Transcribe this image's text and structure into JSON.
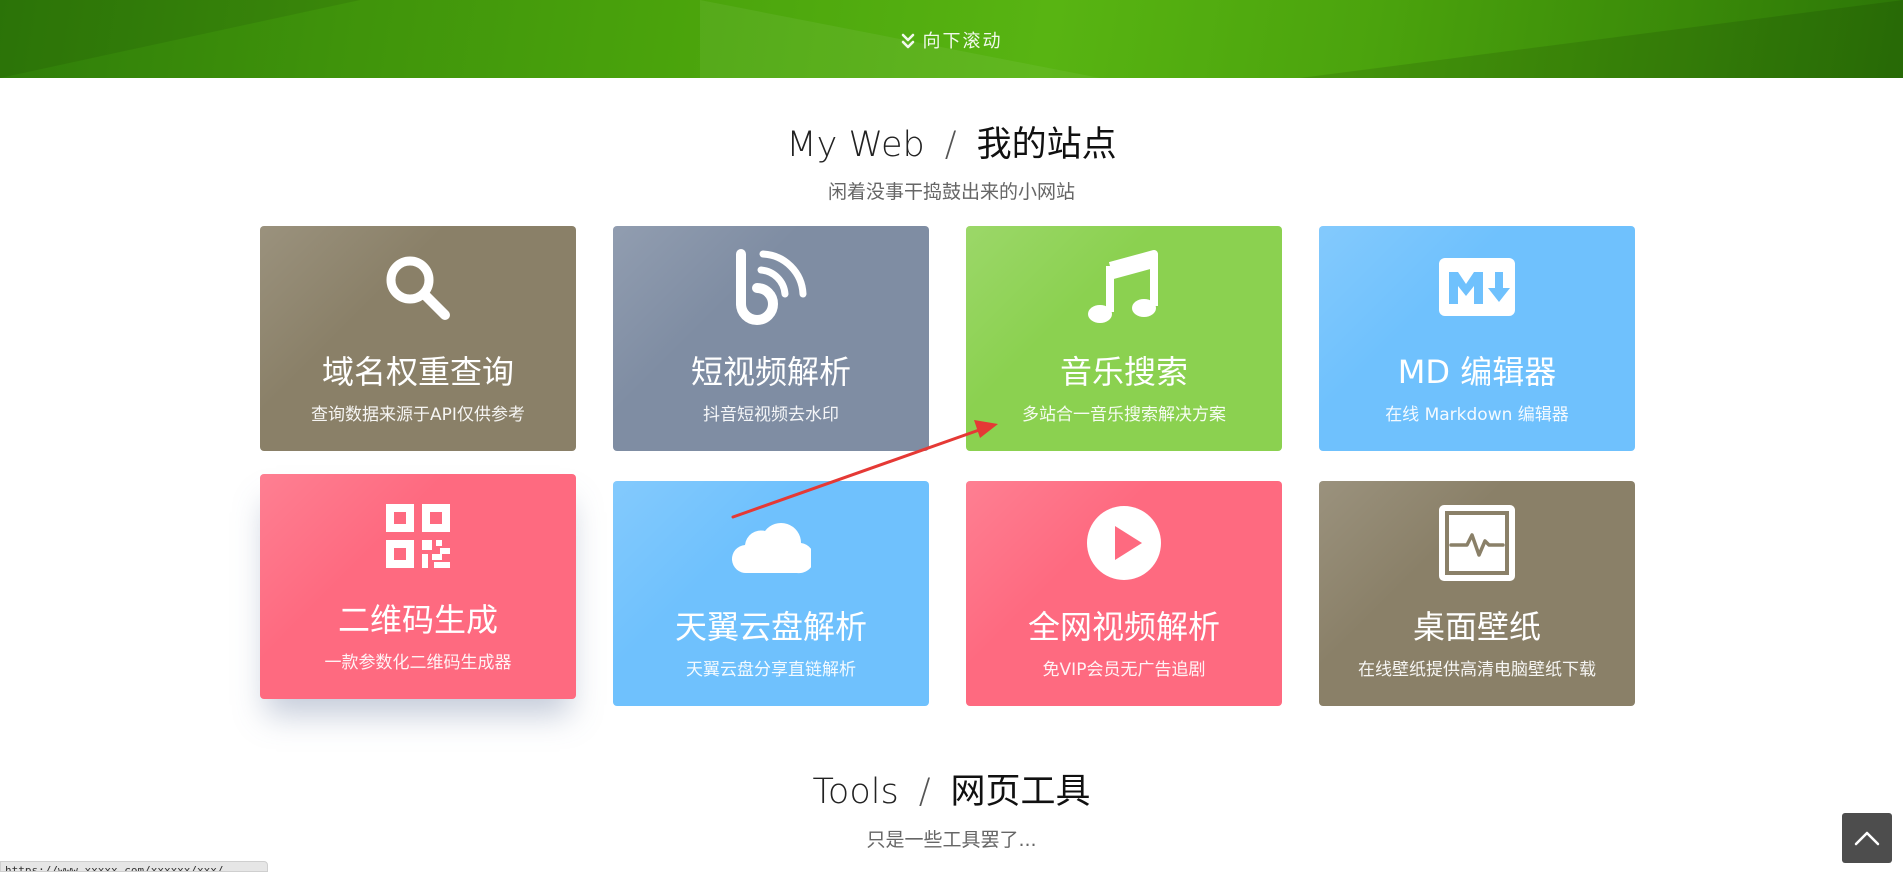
{
  "hero": {
    "scroll_label": "向下滚动"
  },
  "sites": {
    "title_en": "My Web",
    "separator": "/",
    "title_zh": "我的站点",
    "subtitle": "闲着没事干捣鼓出来的小网站",
    "cards": [
      {
        "title": "域名权重查询",
        "desc": "查询数据来源于API仅供参考",
        "icon": "search-icon",
        "color": "#8a8068"
      },
      {
        "title": "短视频解析",
        "desc": "抖音短视频去水印",
        "icon": "rss-b-icon",
        "color": "#7f8da3"
      },
      {
        "title": "音乐搜索",
        "desc": "多站合一音乐搜索解决方案",
        "icon": "music-note-icon",
        "color": "#8bd150"
      },
      {
        "title": "MD 编辑器",
        "desc": "在线 Markdown 编辑器",
        "icon": "markdown-icon",
        "color": "#6fc1fd"
      },
      {
        "title": "二维码生成",
        "desc": "一款参数化二维码生成器",
        "icon": "qrcode-icon",
        "color": "#fe6a80"
      },
      {
        "title": "天翼云盘解析",
        "desc": "天翼云盘分享直链解析",
        "icon": "cloud-icon",
        "color": "#6fc1fd"
      },
      {
        "title": "全网视频解析",
        "desc": "免VIP会员无广告追剧",
        "icon": "play-circle-icon",
        "color": "#fe6a80"
      },
      {
        "title": "桌面壁纸",
        "desc": "在线壁纸提供高清电脑壁纸下载",
        "icon": "monitor-wave-icon",
        "color": "#8a8068"
      }
    ]
  },
  "tools": {
    "title_en": "Tools",
    "separator": "/",
    "title_zh": "网页工具",
    "subtitle": "只是一些工具罢了..."
  },
  "status_bar": {
    "url": "https://www.xxxxx.com/xxxxxx/xxx/"
  },
  "colors": {
    "hero_green": "#4aa30c",
    "annotation_arrow": "#e53935",
    "back_to_top": "#4d4d4d"
  }
}
